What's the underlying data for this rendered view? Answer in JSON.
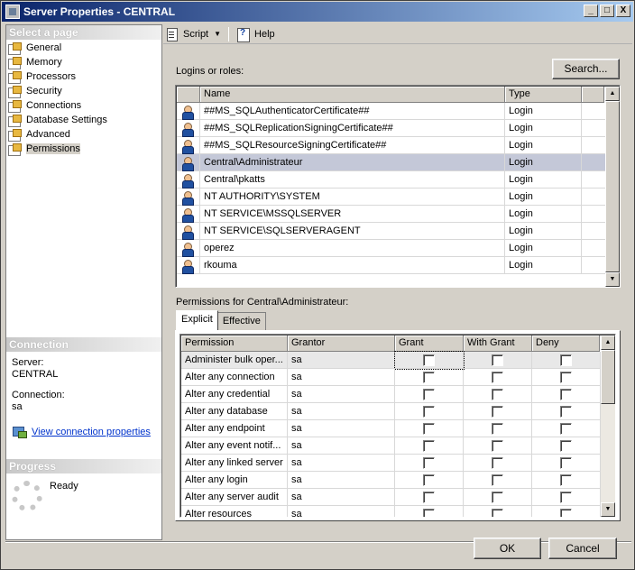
{
  "window": {
    "title": "Server Properties - CENTRAL",
    "controls": [
      "_",
      "□",
      "X"
    ]
  },
  "left": {
    "select_page_header": "Select a page",
    "pages": [
      "General",
      "Memory",
      "Processors",
      "Security",
      "Connections",
      "Database Settings",
      "Advanced",
      "Permissions"
    ],
    "selected_page": "Permissions",
    "connection_header": "Connection",
    "server_label": "Server:",
    "server_value": "CENTRAL",
    "connection_label": "Connection:",
    "connection_value": "sa",
    "view_link": "View connection properties",
    "progress_header": "Progress",
    "progress_status": "Ready"
  },
  "toolbar": {
    "script": "Script",
    "help": "Help"
  },
  "logins": {
    "label": "Logins or roles:",
    "search_button": "Search...",
    "columns": [
      "Name",
      "Type"
    ],
    "rows": [
      {
        "name": "##MS_SQLAuthenticatorCertificate##",
        "type": "Login"
      },
      {
        "name": "##MS_SQLReplicationSigningCertificate##",
        "type": "Login"
      },
      {
        "name": "##MS_SQLResourceSigningCertificate##",
        "type": "Login"
      },
      {
        "name": "Central\\Administrateur",
        "type": "Login",
        "selected": true
      },
      {
        "name": "Central\\pkatts",
        "type": "Login"
      },
      {
        "name": "NT AUTHORITY\\SYSTEM",
        "type": "Login"
      },
      {
        "name": "NT SERVICE\\MSSQLSERVER",
        "type": "Login"
      },
      {
        "name": "NT SERVICE\\SQLSERVERAGENT",
        "type": "Login"
      },
      {
        "name": "operez",
        "type": "Login"
      },
      {
        "name": "rkouma",
        "type": "Login"
      }
    ]
  },
  "permissions": {
    "label": "Permissions for Central\\Administrateur:",
    "tabs": [
      "Explicit",
      "Effective"
    ],
    "active_tab": "Explicit",
    "columns": [
      "Permission",
      "Grantor",
      "Grant",
      "With Grant",
      "Deny"
    ],
    "rows": [
      {
        "permission": "Administer bulk oper...",
        "grantor": "sa",
        "grant": false,
        "with_grant": false,
        "deny": false
      },
      {
        "permission": "Alter any connection",
        "grantor": "sa",
        "grant": false,
        "with_grant": false,
        "deny": false
      },
      {
        "permission": "Alter any credential",
        "grantor": "sa",
        "grant": false,
        "with_grant": false,
        "deny": false
      },
      {
        "permission": "Alter any database",
        "grantor": "sa",
        "grant": false,
        "with_grant": false,
        "deny": false
      },
      {
        "permission": "Alter any endpoint",
        "grantor": "sa",
        "grant": false,
        "with_grant": false,
        "deny": false
      },
      {
        "permission": "Alter any event notif...",
        "grantor": "sa",
        "grant": false,
        "with_grant": false,
        "deny": false
      },
      {
        "permission": "Alter any linked server",
        "grantor": "sa",
        "grant": false,
        "with_grant": false,
        "deny": false
      },
      {
        "permission": "Alter any login",
        "grantor": "sa",
        "grant": false,
        "with_grant": false,
        "deny": false
      },
      {
        "permission": "Alter any server audit",
        "grantor": "sa",
        "grant": false,
        "with_grant": false,
        "deny": false
      },
      {
        "permission": "Alter resources",
        "grantor": "sa",
        "grant": false,
        "with_grant": false,
        "deny": false
      }
    ]
  },
  "buttons": {
    "ok": "OK",
    "cancel": "Cancel"
  }
}
